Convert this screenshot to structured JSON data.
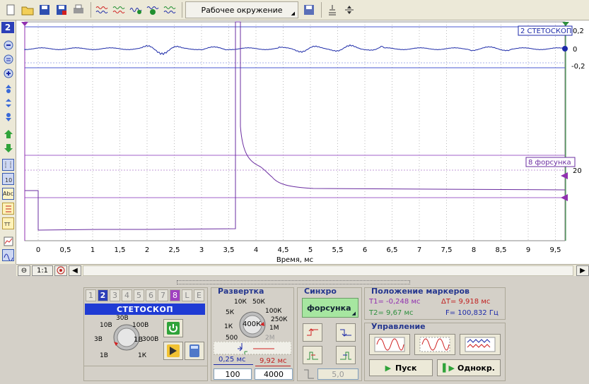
{
  "toolbar": {
    "workspace_label": "Рабочее окружение",
    "buttons": [
      "new-file-icon",
      "open-folder-icon",
      "save-icon",
      "save-as-icon",
      "print-icon",
      "wave-icon-1",
      "wave-icon-2",
      "wave-icon-3",
      "wave-icon-4",
      "wave-icon-5"
    ]
  },
  "left_toolbar": {
    "channel_badge": "2",
    "text_tool": "Abc"
  },
  "plot": {
    "channel_labels": {
      "ch2": "2 СТЕТОСКОП",
      "ch8": "8 форсунка"
    },
    "right_scale": {
      "top": "0,2",
      "mid": "0",
      "bottom": "-0,2",
      "ch8": "20"
    },
    "x_axis_title": "Время, мс",
    "x_ticks": [
      "0",
      "0,5",
      "1",
      "1,5",
      "2",
      "2,5",
      "3",
      "3,5",
      "4",
      "4,5",
      "5",
      "5,5",
      "6",
      "6,5",
      "7",
      "7,5",
      "8",
      "8,5",
      "9",
      "9,5"
    ],
    "colors": {
      "ch2": "#1c2aa8",
      "ch8": "#6a2ca0",
      "grid": "#b9b9b9",
      "axis_marker": "#9030b0"
    }
  },
  "hscroll": {
    "zoom_label": "1:1"
  },
  "channel_panel": {
    "tabs": [
      "1",
      "2",
      "3",
      "4",
      "5",
      "6",
      "7",
      "8",
      "L",
      "E"
    ],
    "active_tab": "2",
    "name": "СТЕТОСКОП",
    "knob_labels": [
      "30В",
      "10В",
      "100В",
      "3В",
      "300В",
      "1В",
      "1В",
      "1К"
    ],
    "knob_value": "1В"
  },
  "sweep_panel": {
    "title": "Развертка",
    "knob_labels": [
      "10К",
      "50К",
      "5К",
      "100К",
      "250К",
      "1К",
      "1М",
      "500",
      "2М"
    ],
    "knob_value": "400К",
    "time_a": "0,25 мс",
    "time_b": "9,92 мс",
    "from_value": "100",
    "to_value": "4000"
  },
  "sync_panel": {
    "title": "Синхро",
    "source": "форсунка",
    "level_value": "5,0"
  },
  "markers_panel": {
    "title": "Положение маркеров",
    "t1": "T1= -0,248 мс",
    "dt": "ΔT= 9,918 мс",
    "t2": "T2= 9,67 мс",
    "f": "F= 100,832 Гц"
  },
  "control_panel": {
    "title": "Управление",
    "start_label": "Пуск",
    "single_label": "Однокр."
  }
}
